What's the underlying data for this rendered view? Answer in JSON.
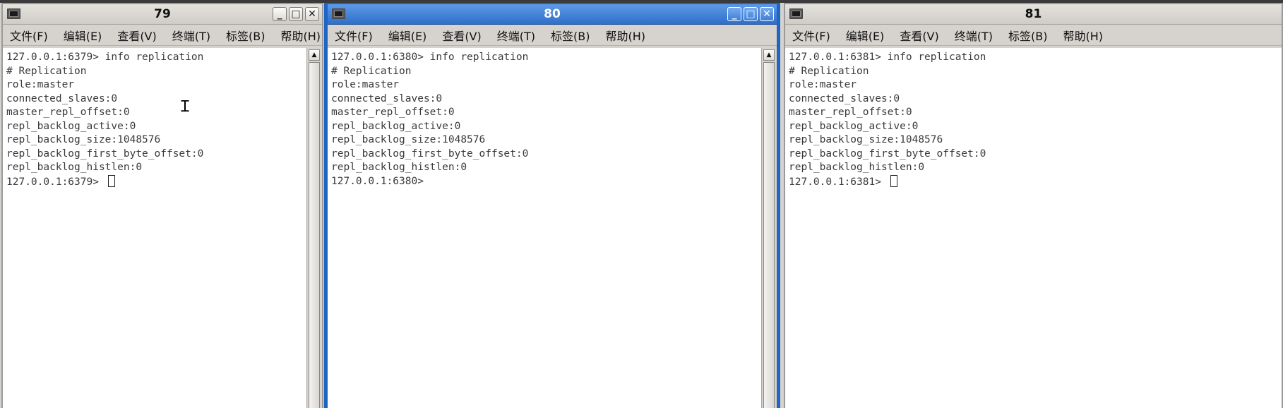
{
  "windows": [
    {
      "title": "79",
      "state": "inactive",
      "menu": [
        "文件(F)",
        "编辑(E)",
        "查看(V)",
        "终端(T)",
        "标签(B)",
        "帮助(H)"
      ],
      "lines": [
        "127.0.0.1:6379> info replication",
        "# Replication",
        "role:master",
        "connected_slaves:0",
        "master_repl_offset:0",
        "repl_backlog_active:0",
        "repl_backlog_size:1048576",
        "repl_backlog_first_byte_offset:0",
        "repl_backlog_histlen:0"
      ],
      "prompt": "127.0.0.1:6379> ",
      "cursor": true
    },
    {
      "title": "80",
      "state": "active",
      "menu": [
        "文件(F)",
        "编辑(E)",
        "查看(V)",
        "终端(T)",
        "标签(B)",
        "帮助(H)"
      ],
      "lines": [
        "127.0.0.1:6380> info replication",
        "# Replication",
        "role:master",
        "connected_slaves:0",
        "master_repl_offset:0",
        "repl_backlog_active:0",
        "repl_backlog_size:1048576",
        "repl_backlog_first_byte_offset:0",
        "repl_backlog_histlen:0"
      ],
      "prompt": "127.0.0.1:6380> ",
      "cursor": false
    },
    {
      "title": "81",
      "state": "inactive",
      "menu": [
        "文件(F)",
        "编辑(E)",
        "查看(V)",
        "终端(T)",
        "标签(B)",
        "帮助(H)"
      ],
      "lines": [
        "127.0.0.1:6381> info replication",
        "# Replication",
        "role:master",
        "connected_slaves:0",
        "master_repl_offset:0",
        "repl_backlog_active:0",
        "repl_backlog_size:1048576",
        "repl_backlog_first_byte_offset:0",
        "repl_backlog_histlen:0"
      ],
      "prompt": "127.0.0.1:6381> ",
      "cursor": true
    }
  ],
  "window_buttons": {
    "minimize": "_",
    "maximize": "□",
    "close": "✕"
  },
  "icons": {
    "window_icon": "terminal-icon",
    "scroll_up": "▲"
  },
  "colors": {
    "active_titlebar": "#2f6fc9",
    "inactive_titlebar": "#d6d3ce",
    "terminal_bg": "#ffffff",
    "terminal_text": "#3a3a3a"
  }
}
